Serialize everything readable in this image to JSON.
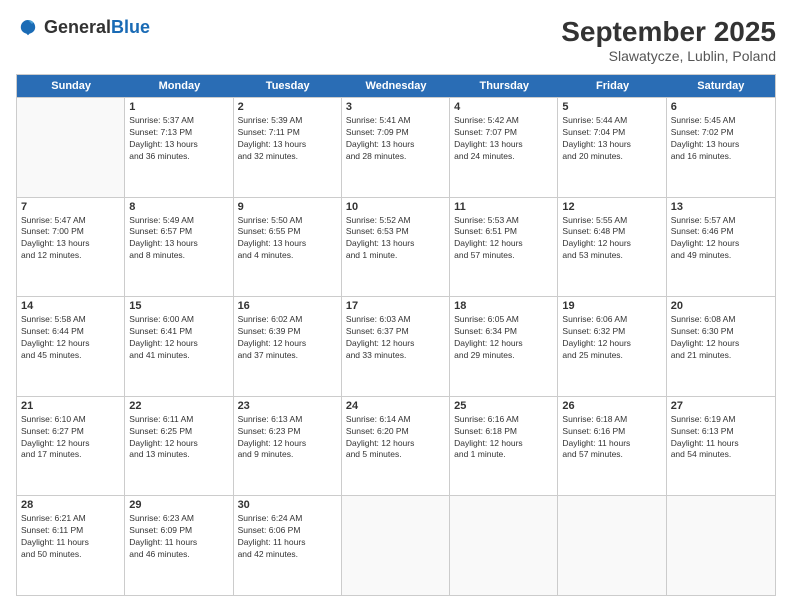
{
  "logo": {
    "general": "General",
    "blue": "Blue"
  },
  "header": {
    "month": "September 2025",
    "location": "Slawatycze, Lublin, Poland"
  },
  "weekdays": [
    "Sunday",
    "Monday",
    "Tuesday",
    "Wednesday",
    "Thursday",
    "Friday",
    "Saturday"
  ],
  "weeks": [
    [
      {
        "day": "",
        "info": ""
      },
      {
        "day": "1",
        "info": "Sunrise: 5:37 AM\nSunset: 7:13 PM\nDaylight: 13 hours\nand 36 minutes."
      },
      {
        "day": "2",
        "info": "Sunrise: 5:39 AM\nSunset: 7:11 PM\nDaylight: 13 hours\nand 32 minutes."
      },
      {
        "day": "3",
        "info": "Sunrise: 5:41 AM\nSunset: 7:09 PM\nDaylight: 13 hours\nand 28 minutes."
      },
      {
        "day": "4",
        "info": "Sunrise: 5:42 AM\nSunset: 7:07 PM\nDaylight: 13 hours\nand 24 minutes."
      },
      {
        "day": "5",
        "info": "Sunrise: 5:44 AM\nSunset: 7:04 PM\nDaylight: 13 hours\nand 20 minutes."
      },
      {
        "day": "6",
        "info": "Sunrise: 5:45 AM\nSunset: 7:02 PM\nDaylight: 13 hours\nand 16 minutes."
      }
    ],
    [
      {
        "day": "7",
        "info": "Sunrise: 5:47 AM\nSunset: 7:00 PM\nDaylight: 13 hours\nand 12 minutes."
      },
      {
        "day": "8",
        "info": "Sunrise: 5:49 AM\nSunset: 6:57 PM\nDaylight: 13 hours\nand 8 minutes."
      },
      {
        "day": "9",
        "info": "Sunrise: 5:50 AM\nSunset: 6:55 PM\nDaylight: 13 hours\nand 4 minutes."
      },
      {
        "day": "10",
        "info": "Sunrise: 5:52 AM\nSunset: 6:53 PM\nDaylight: 13 hours\nand 1 minute."
      },
      {
        "day": "11",
        "info": "Sunrise: 5:53 AM\nSunset: 6:51 PM\nDaylight: 12 hours\nand 57 minutes."
      },
      {
        "day": "12",
        "info": "Sunrise: 5:55 AM\nSunset: 6:48 PM\nDaylight: 12 hours\nand 53 minutes."
      },
      {
        "day": "13",
        "info": "Sunrise: 5:57 AM\nSunset: 6:46 PM\nDaylight: 12 hours\nand 49 minutes."
      }
    ],
    [
      {
        "day": "14",
        "info": "Sunrise: 5:58 AM\nSunset: 6:44 PM\nDaylight: 12 hours\nand 45 minutes."
      },
      {
        "day": "15",
        "info": "Sunrise: 6:00 AM\nSunset: 6:41 PM\nDaylight: 12 hours\nand 41 minutes."
      },
      {
        "day": "16",
        "info": "Sunrise: 6:02 AM\nSunset: 6:39 PM\nDaylight: 12 hours\nand 37 minutes."
      },
      {
        "day": "17",
        "info": "Sunrise: 6:03 AM\nSunset: 6:37 PM\nDaylight: 12 hours\nand 33 minutes."
      },
      {
        "day": "18",
        "info": "Sunrise: 6:05 AM\nSunset: 6:34 PM\nDaylight: 12 hours\nand 29 minutes."
      },
      {
        "day": "19",
        "info": "Sunrise: 6:06 AM\nSunset: 6:32 PM\nDaylight: 12 hours\nand 25 minutes."
      },
      {
        "day": "20",
        "info": "Sunrise: 6:08 AM\nSunset: 6:30 PM\nDaylight: 12 hours\nand 21 minutes."
      }
    ],
    [
      {
        "day": "21",
        "info": "Sunrise: 6:10 AM\nSunset: 6:27 PM\nDaylight: 12 hours\nand 17 minutes."
      },
      {
        "day": "22",
        "info": "Sunrise: 6:11 AM\nSunset: 6:25 PM\nDaylight: 12 hours\nand 13 minutes."
      },
      {
        "day": "23",
        "info": "Sunrise: 6:13 AM\nSunset: 6:23 PM\nDaylight: 12 hours\nand 9 minutes."
      },
      {
        "day": "24",
        "info": "Sunrise: 6:14 AM\nSunset: 6:20 PM\nDaylight: 12 hours\nand 5 minutes."
      },
      {
        "day": "25",
        "info": "Sunrise: 6:16 AM\nSunset: 6:18 PM\nDaylight: 12 hours\nand 1 minute."
      },
      {
        "day": "26",
        "info": "Sunrise: 6:18 AM\nSunset: 6:16 PM\nDaylight: 11 hours\nand 57 minutes."
      },
      {
        "day": "27",
        "info": "Sunrise: 6:19 AM\nSunset: 6:13 PM\nDaylight: 11 hours\nand 54 minutes."
      }
    ],
    [
      {
        "day": "28",
        "info": "Sunrise: 6:21 AM\nSunset: 6:11 PM\nDaylight: 11 hours\nand 50 minutes."
      },
      {
        "day": "29",
        "info": "Sunrise: 6:23 AM\nSunset: 6:09 PM\nDaylight: 11 hours\nand 46 minutes."
      },
      {
        "day": "30",
        "info": "Sunrise: 6:24 AM\nSunset: 6:06 PM\nDaylight: 11 hours\nand 42 minutes."
      },
      {
        "day": "",
        "info": ""
      },
      {
        "day": "",
        "info": ""
      },
      {
        "day": "",
        "info": ""
      },
      {
        "day": "",
        "info": ""
      }
    ]
  ]
}
